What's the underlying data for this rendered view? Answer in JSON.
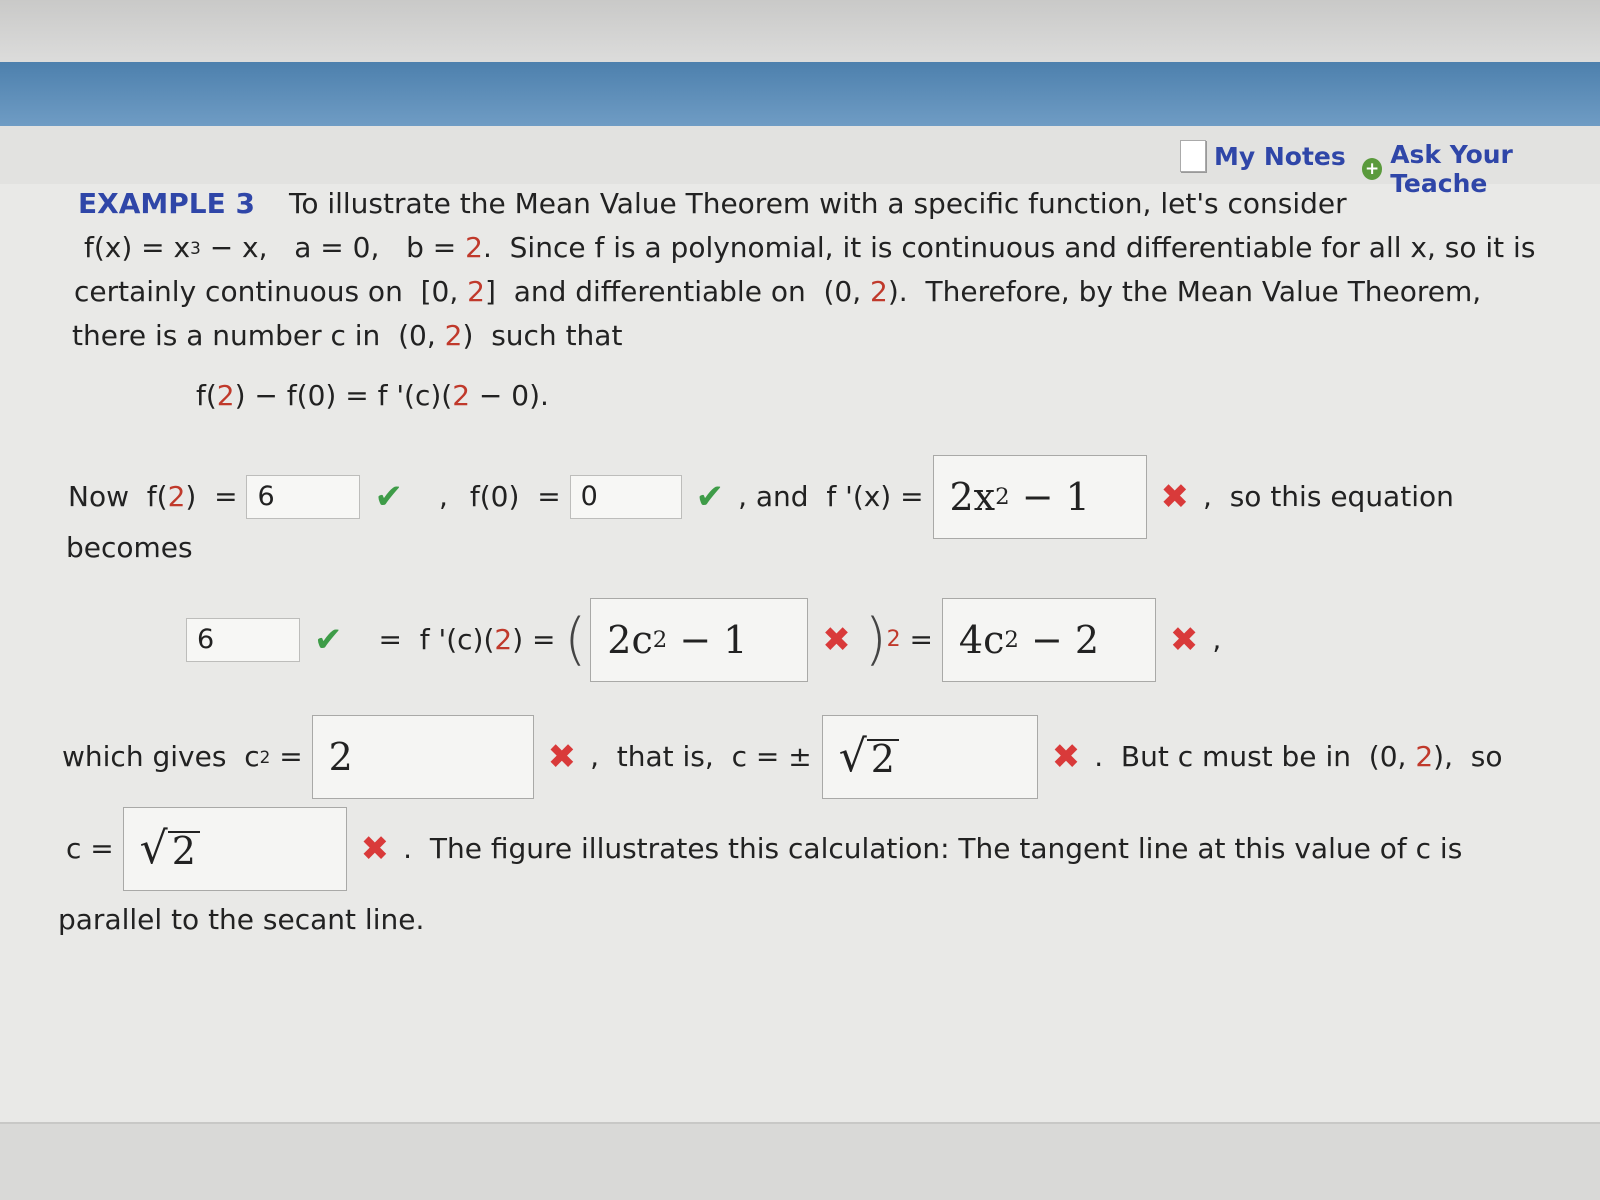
{
  "header": {
    "my_notes": "My Notes",
    "ask_teacher": "Ask Your Teache"
  },
  "example": {
    "label": "EXAMPLE 3",
    "intro": "To illustrate the Mean Value Theorem with a specific function, let's consider",
    "line2_fx": "f(x) = x",
    "line2_exp": "3",
    "line2_rest": " − x,   a = 0,   b = ",
    "two": "2",
    "line2_end": ".  Since f is a polynomial, it is continuous and differentiable for all x, so it is",
    "line3_a": "certainly continuous on  [0, ",
    "line3_b": "]  and differentiable on  (0, ",
    "line3_c": ").  Therefore, by the Mean Value Theorem,",
    "line4_a": "there is a number c in  (0, ",
    "line4_b": ")  such that",
    "eq_a": "f(",
    "eq_b": ") − f(0) = f '(c)(",
    "eq_c": " − 0)."
  },
  "row1": {
    "now": "Now  f(",
    "close": ")  = ",
    "f2_value": "6",
    "comma": ",",
    "f0_label": "f(0)  = ",
    "f0_value": "0",
    "and_label": ", and  f '(x) = ",
    "fprime_value": "2x",
    "fprime_exp": "2",
    "fprime_tail": " − 1",
    "so_this": ",  so this equation",
    "becomes": "becomes"
  },
  "row2": {
    "lhs_value": "6",
    "eq1": "=  f '(c)(",
    "eq1_end": ") = ",
    "inner_value": "2c",
    "inner_exp": "2",
    "inner_tail": " − 1",
    "two_tag": "2",
    "eq2": " = ",
    "rhs_value": "4c",
    "rhs_exp": "2",
    "rhs_tail": " − 2",
    "comma": ","
  },
  "row3": {
    "which": "which gives  c",
    "exp": "2",
    "eq": " = ",
    "c2_value": "2",
    "that_is": ",  that is,  c = ±",
    "sqrt_value": "2",
    "but": ".  But c must be in  (0, ",
    "but_end": "),  so"
  },
  "row4": {
    "c_eq": "c = ",
    "sqrt_value": "2",
    "figure": ".  The figure illustrates this calculation: The tangent line at this value of c is",
    "parallel": "parallel to the secant line."
  }
}
